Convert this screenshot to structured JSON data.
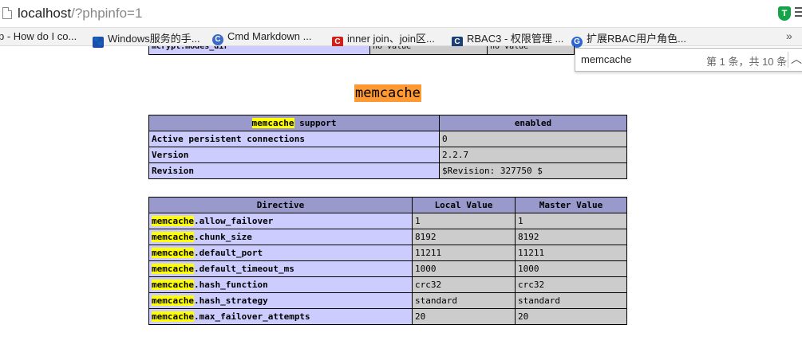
{
  "browser": {
    "url_host": "localhost",
    "url_path": "/?phpinfo=1",
    "bookmarks": [
      {
        "label": "p - How do I co..."
      },
      {
        "label": "Windows服务的手..."
      },
      {
        "label": "Cmd Markdown ..."
      },
      {
        "label": "inner join、join区..."
      },
      {
        "label": "RBAC3 - 权限管理 ..."
      },
      {
        "label": "扩展RBAC用户角色..."
      }
    ],
    "bookmarks_more": "»",
    "find": {
      "query": "memcache",
      "count": "第 1 条，共 10 条",
      "up_glyph": "︿"
    },
    "ext_badge": "T"
  },
  "top_row": {
    "name": "mcrypt.modes_dir",
    "local": "no value",
    "master": "no value"
  },
  "section_title": "memcache",
  "support_table": {
    "header": {
      "highlight": "memcache",
      "rest": " support",
      "value": "enabled"
    },
    "rows": [
      {
        "name": "Active persistent connections",
        "value": "0"
      },
      {
        "name": "Version",
        "value": "2.2.7"
      },
      {
        "name": "Revision",
        "value": "$Revision: 327750 $"
      }
    ]
  },
  "directive_table": {
    "headers": [
      "Directive",
      "Local Value",
      "Master Value"
    ],
    "rows": [
      {
        "prefix": "memcache",
        "name": ".allow_failover",
        "local": "1",
        "master": "1"
      },
      {
        "prefix": "memcache",
        "name": ".chunk_size",
        "local": "8192",
        "master": "8192"
      },
      {
        "prefix": "memcache",
        "name": ".default_port",
        "local": "11211",
        "master": "11211"
      },
      {
        "prefix": "memcache",
        "name": ".default_timeout_ms",
        "local": "1000",
        "master": "1000"
      },
      {
        "prefix": "memcache",
        "name": ".hash_function",
        "local": "crc32",
        "master": "crc32"
      },
      {
        "prefix": "memcache",
        "name": ".hash_strategy",
        "local": "standard",
        "master": "standard"
      },
      {
        "prefix": "memcache",
        "name": ".max_failover_attempts",
        "local": "20",
        "master": "20"
      }
    ]
  }
}
